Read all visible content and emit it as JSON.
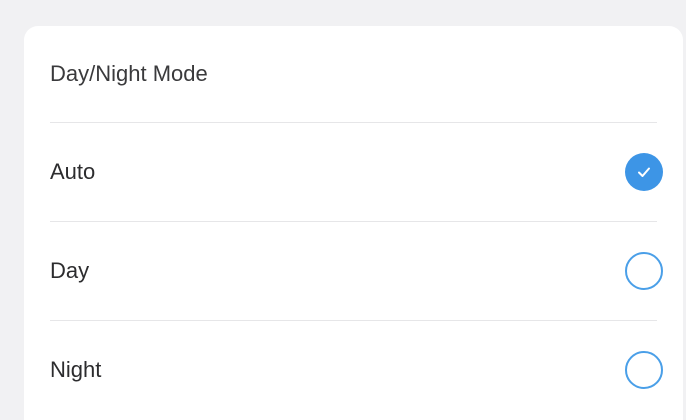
{
  "title": "Day/Night Mode",
  "accent_color": "#3d95e6",
  "options": [
    {
      "label": "Auto",
      "selected": true
    },
    {
      "label": "Day",
      "selected": false
    },
    {
      "label": "Night",
      "selected": false
    }
  ],
  "icons": {
    "selected": "checkmark-circle-icon",
    "unselected": "empty-circle-icon"
  }
}
